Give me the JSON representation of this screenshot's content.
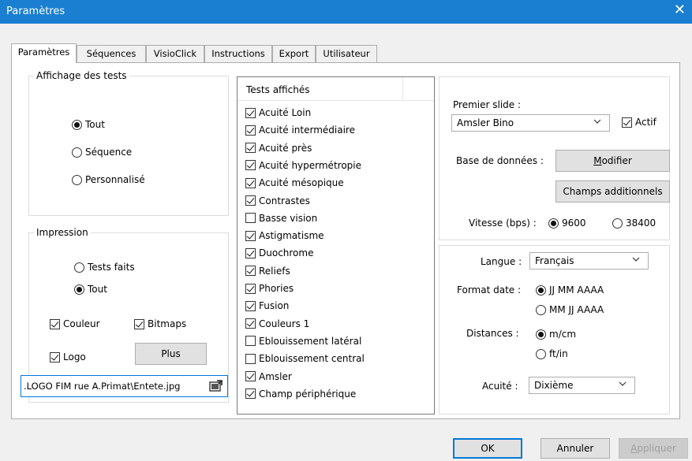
{
  "window": {
    "title": "Paramètres",
    "close": "✕"
  },
  "tabs": [
    {
      "label": "Paramètres"
    },
    {
      "label": "Séquences"
    },
    {
      "label": "VisioClick"
    },
    {
      "label": "Instructions"
    },
    {
      "label": "Export"
    },
    {
      "label": "Utilisateur"
    }
  ],
  "affichage": {
    "title": "Affichage des tests",
    "options": [
      {
        "label": "Tout",
        "selected": true
      },
      {
        "label": "Séquence",
        "selected": false
      },
      {
        "label": "Personnalisé",
        "selected": false
      }
    ]
  },
  "impression": {
    "title": "Impression",
    "options": [
      {
        "label": "Tests faits",
        "selected": false
      },
      {
        "label": "Tout",
        "selected": true
      }
    ],
    "couleur": {
      "label": "Couleur",
      "checked": true
    },
    "bitmaps": {
      "label": "Bitmaps",
      "checked": true
    },
    "logo": {
      "label": "Logo",
      "checked": true
    },
    "plus_label": "Plus",
    "file_path": ".LOGO FIM rue A.Primat\\Entete.jpg"
  },
  "tests": {
    "header": "Tests affichés",
    "items": [
      {
        "label": "Acuité Loin",
        "checked": true
      },
      {
        "label": "Acuité intermédiaire",
        "checked": true
      },
      {
        "label": "Acuité près",
        "checked": true
      },
      {
        "label": "Acuité hypermétropie",
        "checked": true
      },
      {
        "label": "Acuité mésopique",
        "checked": true
      },
      {
        "label": "Contrastes",
        "checked": true
      },
      {
        "label": "Basse vision",
        "checked": false
      },
      {
        "label": "Astigmatisme",
        "checked": true
      },
      {
        "label": "Duochrome",
        "checked": true
      },
      {
        "label": "Reliefs",
        "checked": true
      },
      {
        "label": "Phories",
        "checked": true
      },
      {
        "label": "Fusion",
        "checked": true
      },
      {
        "label": "Couleurs 1",
        "checked": true
      },
      {
        "label": "Eblouissement latéral",
        "checked": false
      },
      {
        "label": "Eblouissement central",
        "checked": false
      },
      {
        "label": "Amsler",
        "checked": true
      },
      {
        "label": "Champ périphérique",
        "checked": true
      }
    ]
  },
  "premier": {
    "label": "Premier slide :",
    "value": "Amsler Bino",
    "actif": {
      "label": "Actif",
      "checked": true
    }
  },
  "base": {
    "label": "Base de données :",
    "modifier_m": "M",
    "modifier_rest": "odifier",
    "champs_label": "Champs additionnels"
  },
  "vitesse": {
    "label": "Vitesse (bps) :",
    "options": [
      {
        "label": "9600",
        "selected": true
      },
      {
        "label": "38400",
        "selected": false
      }
    ]
  },
  "langue": {
    "label": "Langue :",
    "value": "Français"
  },
  "format": {
    "label": "Format date :",
    "options": [
      {
        "label": "JJ MM AAAA",
        "selected": true
      },
      {
        "label": "MM JJ AAAA",
        "selected": false
      }
    ]
  },
  "distances": {
    "label": "Distances :",
    "options": [
      {
        "label": "m/cm",
        "selected": true
      },
      {
        "label": "ft/in",
        "selected": false
      }
    ]
  },
  "acuite": {
    "label": "Acuité :",
    "value": "Dixième"
  },
  "footer": {
    "ok_label": "OK",
    "annuler_label": "Annuler",
    "appliquer_a": "A",
    "appliquer_rest": "ppliquer"
  },
  "colors": {
    "titlebar": "#1a7fd0",
    "focus": "#0078d7"
  },
  "icons": {
    "close": "close-icon",
    "file": "folder-picture-icon",
    "chevron": "chevron-down-icon"
  }
}
